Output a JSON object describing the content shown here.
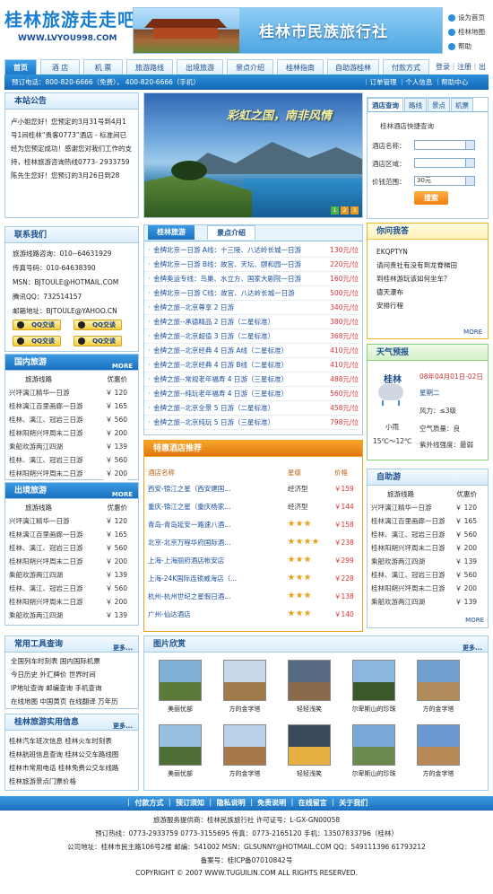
{
  "header": {
    "logo_cn": "桂林旅游走走吧",
    "logo_url": "WWW.LVYOU998.COM",
    "banner_title": "桂林市民族旅行社",
    "links": [
      "设为首页",
      "桂林地图",
      "帮助"
    ]
  },
  "nav": {
    "items": [
      "首页",
      "酒 店",
      "机 票",
      "旅游路线",
      "出境旅游",
      "景点介绍",
      "桂林指南",
      "自助游桂林",
      "付款方式"
    ],
    "right": "登录｜注册｜出"
  },
  "infobar": {
    "phone": "预订电话：800-820-6666（免费）， 400-820-6666（手机）",
    "links": "｜订单管理 ｜个人信息 ｜帮助中心"
  },
  "notice": {
    "title": "本站公告",
    "text": "卢小姐您好！您预定的3月31号到4月1号1间桂林“贵客0773”酒店 - 标准间已经为您预定成功！感谢您对我们工作的支持，桂林旅游咨询热线0773- 2933759\n陈先生您好！您预订的3月26日到28"
  },
  "slide": {
    "text": "彩虹之国，南非风情",
    "dots": [
      "1",
      "2",
      "3"
    ]
  },
  "hotel_search": {
    "tabs": [
      "酒店查询",
      "路线",
      "景点",
      "机票"
    ],
    "subtitle": "桂林酒店快捷查询",
    "name_label": "酒店名称：",
    "area_label": "酒店区域：",
    "price_label": "价钱范围：",
    "price_value": "30元",
    "search_btn": "搜索"
  },
  "contact": {
    "title": "联系我们",
    "lines": [
      "旅游线路咨询：010--64631929",
      "传真号码：010-64638390",
      "MSN：BJTOULE@HOTMAIL.COM",
      "腾讯QQ：732514157",
      "邮箱地址：BJTOULE@YAHOO.CN"
    ],
    "qq_label": "QQ交谈"
  },
  "domestic": {
    "title": "国内旅游",
    "more": "MORE",
    "col1": "旅游线路",
    "col2": "优惠价",
    "rows": [
      {
        "n": "兴坪漓江精华一日游",
        "p": "￥ 120"
      },
      {
        "n": "桂林漓江百里画廊一日游",
        "p": "￥ 165"
      },
      {
        "n": "桂林、漓江、冠岩三日游",
        "p": "￥ 560"
      },
      {
        "n": "桂林阳朔兴坪周末二日游",
        "p": "￥ 200"
      },
      {
        "n": "乘船欢游两江四湖",
        "p": "￥ 139"
      },
      {
        "n": "桂林、漓江、冠岩三日游",
        "p": "￥ 560"
      },
      {
        "n": "桂林阳朔兴坪周末二日游",
        "p": "￥ 200"
      }
    ]
  },
  "outbound": {
    "title": "出境旅游",
    "more": "MORE",
    "col1": "旅游线路",
    "col2": "优惠价",
    "rows": [
      {
        "n": "兴坪漓江精华一日游",
        "p": "￥ 120"
      },
      {
        "n": "桂林漓江百里画廊一日游",
        "p": "￥ 165"
      },
      {
        "n": "桂林、漓江、冠岩三日游",
        "p": "￥ 560"
      },
      {
        "n": "桂林阳朔兴坪周末二日游",
        "p": "￥ 200"
      },
      {
        "n": "乘船欢游两江四湖",
        "p": "￥ 139"
      },
      {
        "n": "桂林、漓江、冠岩三日游",
        "p": "￥ 560"
      },
      {
        "n": "桂林阳朔兴坪周末二日游",
        "p": "￥ 200"
      },
      {
        "n": "乘船欢游两江四湖",
        "p": "￥ 139"
      }
    ]
  },
  "jinpai": {
    "tab1": "桂林旅游",
    "tab2": "景点介绍",
    "rows": [
      {
        "t": "金牌北京一日游 A线：十三陵、八达岭长城一日游",
        "p": "130元/位"
      },
      {
        "t": "金牌北京一日游 B线：故宫、天坛、颐和园一日游",
        "p": "220元/位"
      },
      {
        "t": "金牌奥运专线：鸟巢、水立方、国家大剧院一日游",
        "p": "160元/位"
      },
      {
        "t": "金牌北京一日游 C线：故宫、八达岭长城一日游",
        "p": "500元/位"
      },
      {
        "t": "金牌之旅--北京尊享 2 日游",
        "p": "340元/位"
      },
      {
        "t": "金牌之旅--承德精品 2 日游（二星标准）",
        "p": "380元/位"
      },
      {
        "t": "金牌之旅--北京超值 3 日游（二星标准）",
        "p": "368元/位"
      },
      {
        "t": "金牌之旅--北京经典 4 日游 A线（二星标准）",
        "p": "410元/位"
      },
      {
        "t": "金牌之旅--北京经典 4 日游 B线（二星标准）",
        "p": "410元/位"
      },
      {
        "t": "金牌之旅--常规老年福寿 4 日游（三星标准）",
        "p": "488元/位"
      },
      {
        "t": "金牌之旅--纯玩老年福寿 4 日游（三星标准）",
        "p": "560元/位"
      },
      {
        "t": "金牌之旅--北京全景 5 日游（二星标准）",
        "p": "458元/位"
      },
      {
        "t": "金牌之旅--北京纯玩 5 日游（三星标准）",
        "p": "798元/位"
      }
    ]
  },
  "faq": {
    "title": "你问我答",
    "qs": [
      "EKQPTYN",
      "请问贵社有没有到龙脊梯田",
      "到桂林游玩该如何坐车？",
      "德天瀑布",
      "安排行程"
    ],
    "more": "MORE"
  },
  "weather": {
    "title": "天气预报",
    "city": "桂林",
    "date": "08年04月01日-02日",
    "weekday": "星期二",
    "cond": "小雨",
    "wind": "风力：≤3级",
    "temp": "15℃～12℃",
    "air": "空气质量：良",
    "uv": "紫外线强度：最弱"
  },
  "hotel_rec": {
    "title": "特惠酒店推荐",
    "cols": [
      "酒店名称",
      "星级",
      "价格"
    ],
    "rows": [
      {
        "n": "西安-锦江之星（西安建国...",
        "g": "经济型",
        "s": 0,
        "p": "￥159"
      },
      {
        "n": "重庆-锦江之星（重庆杨家...",
        "g": "经济型",
        "s": 0,
        "p": "￥144"
      },
      {
        "n": "青岛-青岛延安一路速八酒...",
        "g": "",
        "s": 3,
        "p": "￥158"
      },
      {
        "n": "北京-北京万程华府国际酒...",
        "g": "",
        "s": 4,
        "p": "￥238"
      },
      {
        "n": "上海-上海丽府酒店帐安店",
        "g": "",
        "s": 3,
        "p": "￥299"
      },
      {
        "n": "上海-24K国际连锁威海店（...",
        "g": "",
        "s": 3,
        "p": "￥228"
      },
      {
        "n": "杭州-杭州世纪之星假日酒...",
        "g": "",
        "s": 3,
        "p": "￥138"
      },
      {
        "n": "广州-仙达酒店",
        "g": "",
        "s": 3,
        "p": "￥140"
      }
    ]
  },
  "self": {
    "title": "自助游",
    "more": "MORE",
    "col1": "旅游线路",
    "col2": "优惠价",
    "rows": [
      {
        "n": "兴坪漓江精华一日游",
        "p": "￥ 120"
      },
      {
        "n": "桂林漓江百里画廊一日游",
        "p": "￥ 165"
      },
      {
        "n": "桂林、漓江、冠岩三日游",
        "p": "￥ 560"
      },
      {
        "n": "桂林阳朔兴坪周末二日游",
        "p": "￥ 200"
      },
      {
        "n": "乘船欢游两江四湖",
        "p": "￥ 139"
      },
      {
        "n": "桂林、漓江、冠岩三日游",
        "p": "￥ 560"
      },
      {
        "n": "桂林阳朔兴坪周末二日游",
        "p": "￥ 200"
      },
      {
        "n": "乘船欢游两江四湖",
        "p": "￥ 139"
      }
    ]
  },
  "tools": {
    "title": "常用工具查询",
    "more": "更多...",
    "lines": [
      "全国列车时刻表   国内国际机票",
      "今日历史  外汇牌价  世界时间",
      "IP地址查询  邮编查询  手机查询",
      "在线地图  中国黄页  在线翻译  万年历"
    ]
  },
  "useful": {
    "title": "桂林旅游实用信息",
    "more": "更多...",
    "lines": [
      "桂林汽车班次信息    桂林火车时刻表",
      "桂林航班信息查询  桂林公交车路线图",
      "桂林市常用电话  桂林免费公交车线路",
      "桂林旅游景点门票价格"
    ]
  },
  "gallery": {
    "title": "图片欣赏",
    "more": "更多...",
    "captions": [
      "美丽忧部",
      "方的金字塔",
      "轻轻浅笑",
      "尔卑斯山的珍珠",
      "方的金字塔",
      "美丽忧部",
      "方的金字塔",
      "轻轻浅笑",
      "尔卑斯山的珍珠",
      "方的金字塔"
    ]
  },
  "footer": {
    "links": "｜ 付款方式 ｜ 预订须知 ｜ 隐私说明 ｜ 免责说明 ｜ 在线留言 ｜ 关于我们",
    "l1": "旅游服务提供商：桂林民族旅行社 许可证号：L-GX-GN00058",
    "l2": "预订热线：0773-2933759 0773-3155695 传真：0773-2165120 手机：13507833796（桂林）",
    "l3": "公司地址：桂林市民主路106号2楼  邮编：541002  MSN：GLSUNNY@HOTMAIL.COM  QQ：549111396 61793212",
    "l4": "备案号：桂ICP备07010842号",
    "l5": "COPYRIGHT © 2007 WWW.TUGUILIN.COM ALL RIGHTS RESERVED."
  },
  "colors": {
    "primary": "#1a78c8",
    "accent": "#f08010",
    "price": "#dd3333"
  }
}
